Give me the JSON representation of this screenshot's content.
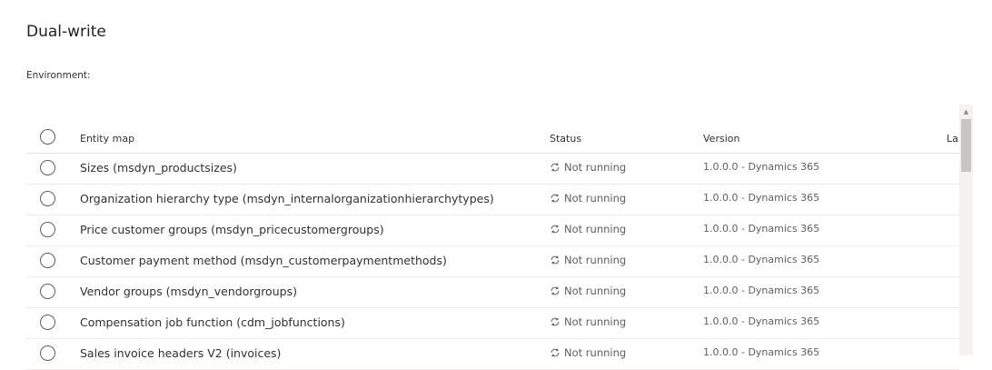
{
  "page": {
    "title": "Dual-write",
    "environment_label": "Environment:"
  },
  "table": {
    "columns": {
      "entity_map": "Entity map",
      "status": "Status",
      "version": "Version",
      "last": "La"
    },
    "rows": [
      {
        "entity_map": "Sizes (msdyn_productsizes)",
        "status": "Not running",
        "version": "1.0.0.0 - Dynamics 365"
      },
      {
        "entity_map": "Organization hierarchy type (msdyn_internalorganizationhierarchytypes)",
        "status": "Not running",
        "version": "1.0.0.0 - Dynamics 365"
      },
      {
        "entity_map": "Price customer groups (msdyn_pricecustomergroups)",
        "status": "Not running",
        "version": "1.0.0.0 - Dynamics 365"
      },
      {
        "entity_map": "Customer payment method (msdyn_customerpaymentmethods)",
        "status": "Not running",
        "version": "1.0.0.0 - Dynamics 365"
      },
      {
        "entity_map": "Vendor groups (msdyn_vendorgroups)",
        "status": "Not running",
        "version": "1.0.0.0 - Dynamics 365"
      },
      {
        "entity_map": "Compensation job function (cdm_jobfunctions)",
        "status": "Not running",
        "version": "1.0.0.0 - Dynamics 365"
      },
      {
        "entity_map": "Sales invoice headers V2 (invoices)",
        "status": "Not running",
        "version": "1.0.0.0 - Dynamics 365"
      }
    ]
  },
  "icons": {
    "status": "sync-icon",
    "radio": "radio-circle",
    "scroll_up": "chevron-up-icon"
  }
}
